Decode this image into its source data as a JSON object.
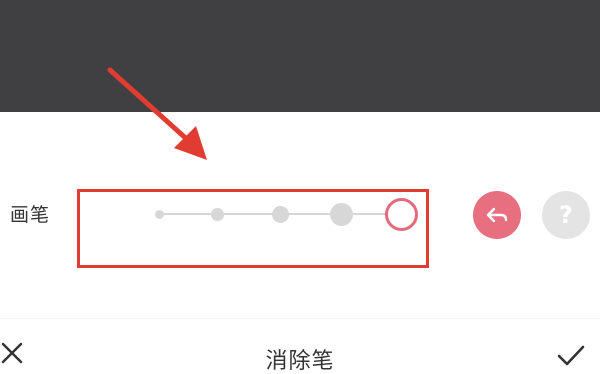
{
  "brush": {
    "label": "画笔",
    "sizes": [
      "xs",
      "s",
      "m",
      "l",
      "xl"
    ],
    "selected_size": "xl"
  },
  "actions": {
    "undo_icon": "undo-icon",
    "help_label": "?"
  },
  "bottom_bar": {
    "title": "消除笔",
    "close_icon": "close-icon",
    "confirm_icon": "check-icon"
  },
  "colors": {
    "preview_bg": "#404042",
    "accent": "#e76f7f",
    "annotation_red": "#e03c31"
  }
}
